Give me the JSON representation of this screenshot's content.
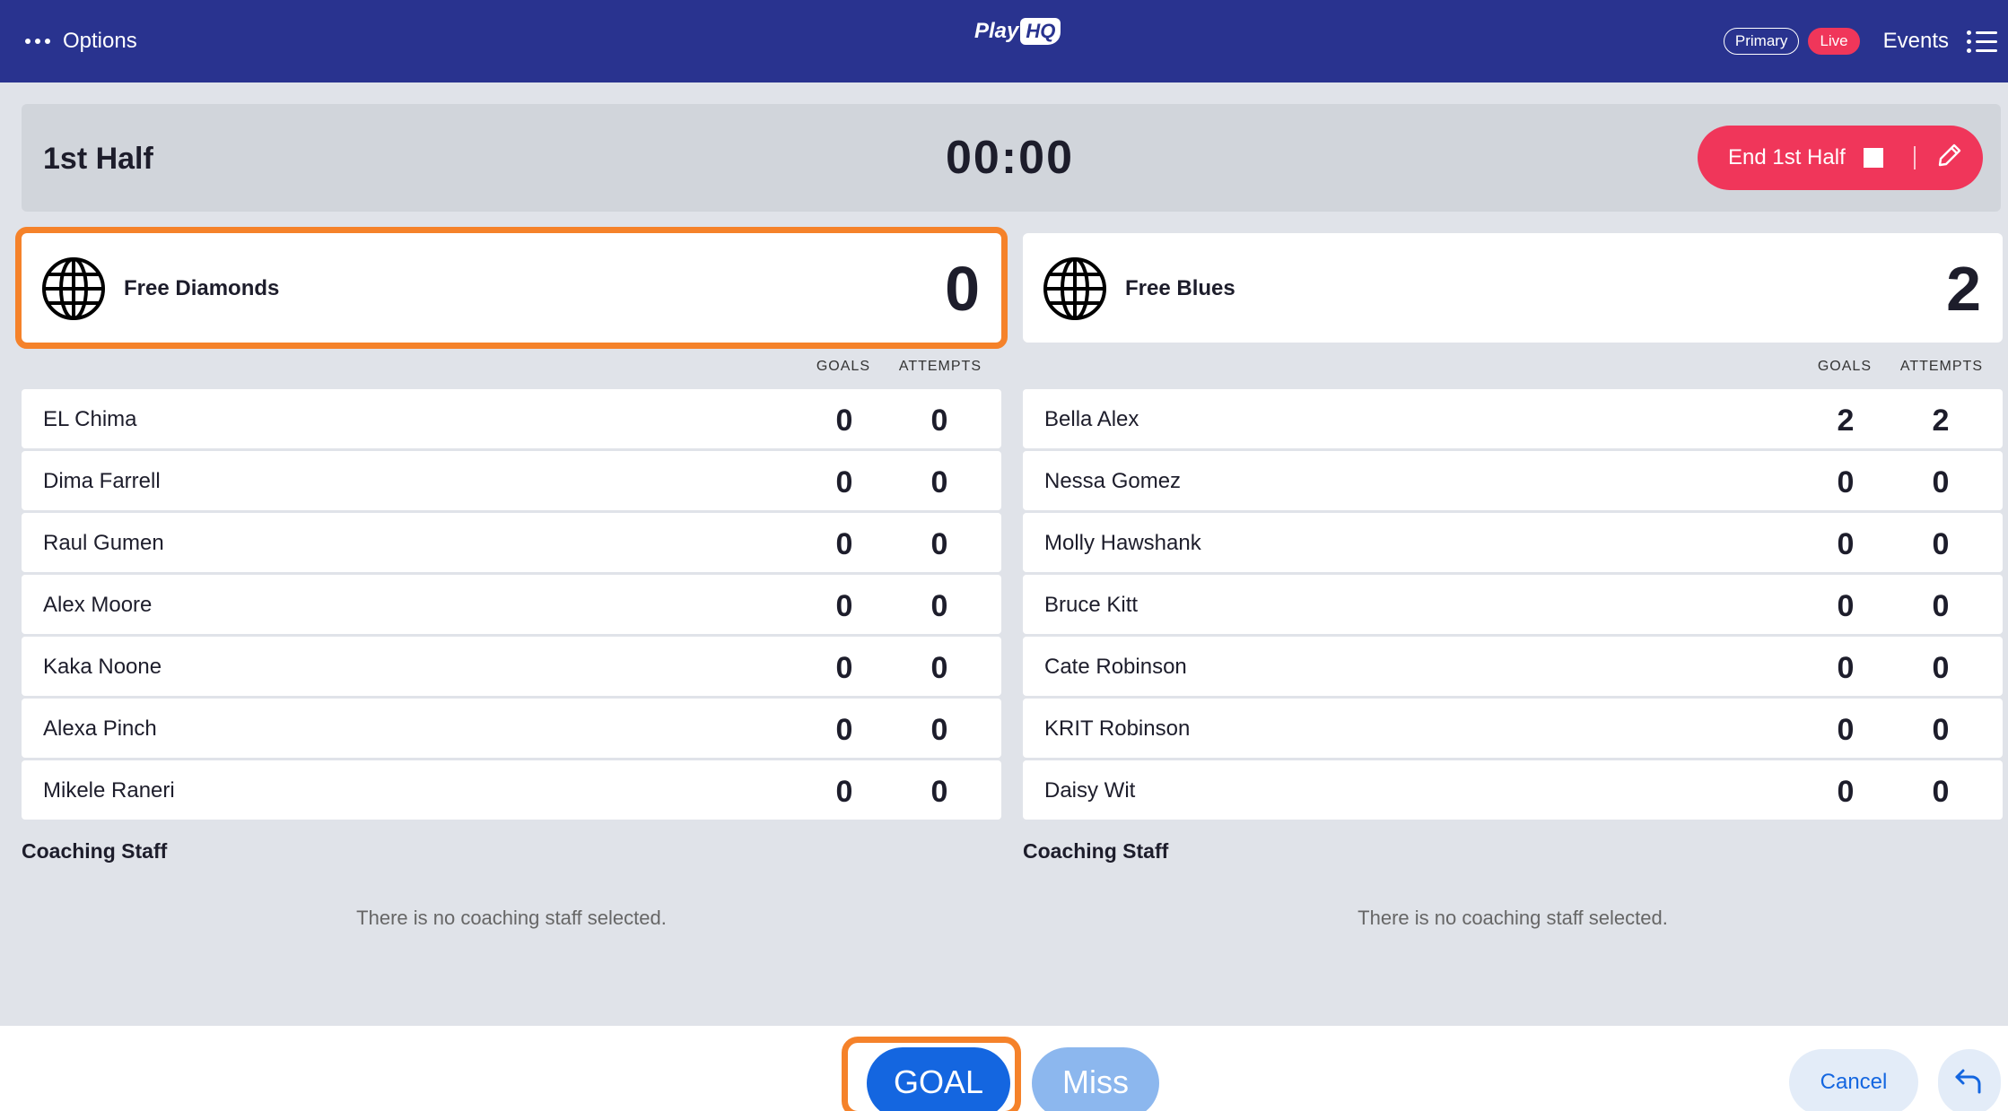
{
  "topbar": {
    "options_label": "Options",
    "logo_play": "Play",
    "logo_hq": "HQ",
    "primary_label": "Primary",
    "live_label": "Live",
    "events_label": "Events"
  },
  "period": {
    "title": "1st Half",
    "clock": "00:00",
    "end_label": "End 1st Half"
  },
  "columns": {
    "goals": "GOALS",
    "attempts": "ATTEMPTS"
  },
  "teams": [
    {
      "name": "Free Diamonds",
      "score": "0",
      "players": [
        {
          "name": "EL Chima",
          "goals": "0",
          "attempts": "0"
        },
        {
          "name": "Dima Farrell",
          "goals": "0",
          "attempts": "0"
        },
        {
          "name": "Raul Gumen",
          "goals": "0",
          "attempts": "0"
        },
        {
          "name": "Alex Moore",
          "goals": "0",
          "attempts": "0"
        },
        {
          "name": "Kaka Noone",
          "goals": "0",
          "attempts": "0"
        },
        {
          "name": "Alexa Pinch",
          "goals": "0",
          "attempts": "0"
        },
        {
          "name": "Mikele Raneri",
          "goals": "0",
          "attempts": "0"
        }
      ],
      "coaching_title": "Coaching Staff",
      "coaching_empty": "There is no coaching staff selected."
    },
    {
      "name": "Free Blues",
      "score": "2",
      "players": [
        {
          "name": "Bella Alex",
          "goals": "2",
          "attempts": "2"
        },
        {
          "name": "Nessa Gomez",
          "goals": "0",
          "attempts": "0"
        },
        {
          "name": "Molly Hawshank",
          "goals": "0",
          "attempts": "0"
        },
        {
          "name": "Bruce Kitt",
          "goals": "0",
          "attempts": "0"
        },
        {
          "name": "Cate Robinson",
          "goals": "0",
          "attempts": "0"
        },
        {
          "name": "KRIT Robinson",
          "goals": "0",
          "attempts": "0"
        },
        {
          "name": "Daisy Wit",
          "goals": "0",
          "attempts": "0"
        }
      ],
      "coaching_title": "Coaching Staff",
      "coaching_empty": "There is no coaching staff selected."
    }
  ],
  "actions": {
    "goal_label": "GOAL",
    "miss_label": "Miss",
    "cancel_label": "Cancel"
  },
  "colors": {
    "topbar": "#29338f",
    "accent_red": "#f0365a",
    "primary_blue": "#1466e0",
    "highlight_orange": "#f5822a"
  }
}
